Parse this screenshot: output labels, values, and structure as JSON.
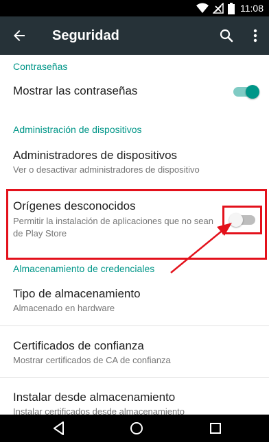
{
  "status_bar": {
    "time": "11:08"
  },
  "app_bar": {
    "title": "Seguridad"
  },
  "sections": {
    "passwords": {
      "header": "Contraseñas",
      "show_passwords": {
        "title": "Mostrar las contraseñas",
        "enabled": true
      }
    },
    "device_admin": {
      "header": "Administración de dispositivos",
      "admins": {
        "title": "Administradores de dispositivos",
        "subtitle": "Ver o desactivar administradores de dispositivo"
      },
      "unknown_sources": {
        "title": "Orígenes desconocidos",
        "subtitle": "Permitir la instalación de aplicaciones que no sean de Play Store",
        "enabled": false
      }
    },
    "credential_storage": {
      "header": "Almacenamiento de credenciales",
      "storage_type": {
        "title": "Tipo de almacenamiento",
        "subtitle": "Almacenado en hardware"
      },
      "trusted_certs": {
        "title": "Certificados de confianza",
        "subtitle": "Mostrar certificados de CA de confianza"
      },
      "install_from_storage": {
        "title": "Instalar desde almacenamiento",
        "subtitle": "Instalar certificados desde almacenamiento"
      }
    }
  },
  "colors": {
    "accent": "#009688",
    "app_bar": "#263238",
    "annotation": "#e3111b"
  }
}
